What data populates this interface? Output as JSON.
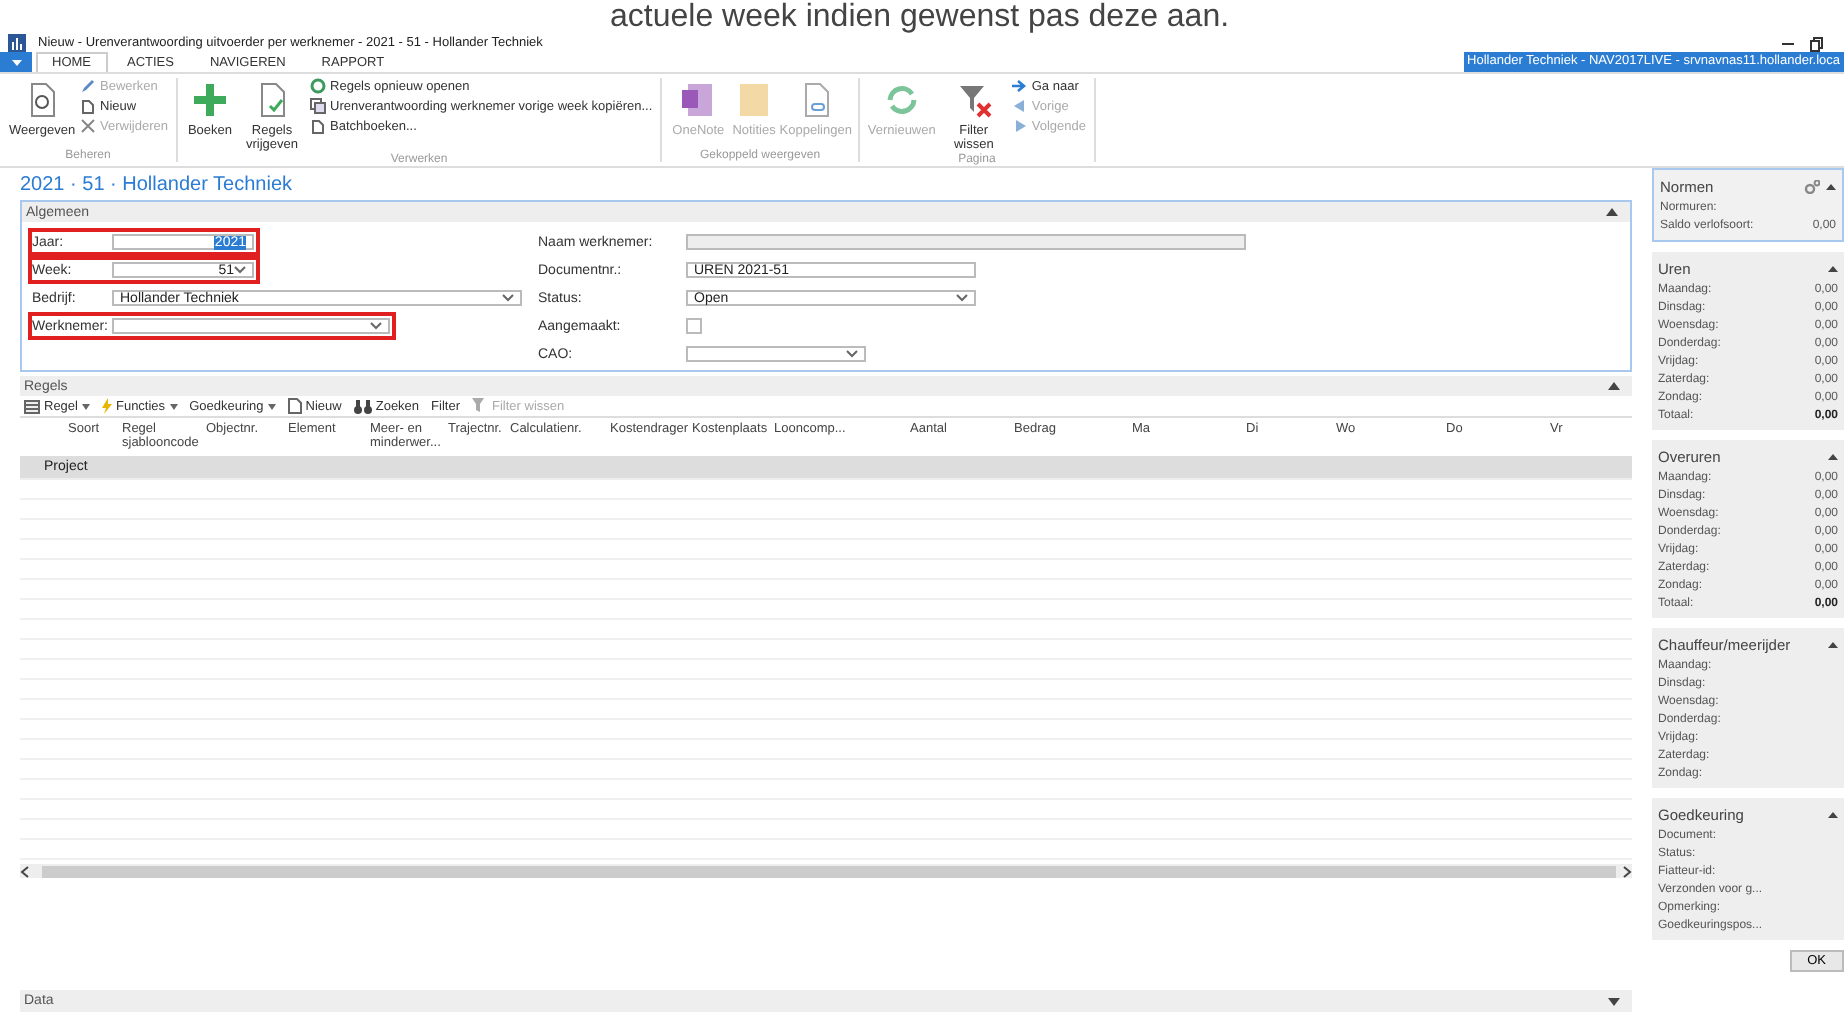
{
  "caption": "actuele week indien gewenst pas deze aan.",
  "window": {
    "title": "Nieuw - Urenverantwoording uitvoerder per werknemer - 2021 - 51 - Hollander Techniek"
  },
  "ribbon": {
    "tabs": [
      {
        "label": "HOME",
        "selected": true
      },
      {
        "label": "ACTIES",
        "selected": false
      },
      {
        "label": "NAVIGEREN",
        "selected": false
      },
      {
        "label": "RAPPORT",
        "selected": false
      }
    ],
    "server": "Hollander Techniek - NAV2017LIVE - srvnavnas11.hollander.loca",
    "groups": [
      {
        "label": "Beheren",
        "large": [
          {
            "label": "Weergeven",
            "disabled": false
          }
        ],
        "small": [
          {
            "label": "Bewerken",
            "disabled": true
          },
          {
            "label": "Nieuw",
            "disabled": false
          },
          {
            "label": "Verwijderen",
            "disabled": true
          }
        ]
      },
      {
        "label": "Verwerken",
        "large": [
          {
            "label": "Boeken",
            "disabled": false
          },
          {
            "label": "Regels vrijgeven",
            "disabled": false
          }
        ],
        "small": [
          {
            "label": "Regels opnieuw openen",
            "disabled": false
          },
          {
            "label": "Urenverantwoording werknemer vorige week kopiëren...",
            "disabled": false
          },
          {
            "label": "Batchboeken...",
            "disabled": false
          }
        ]
      },
      {
        "label": "Gekoppeld weergeven",
        "large": [
          {
            "label": "OneNote",
            "disabled": true
          },
          {
            "label": "Notities",
            "disabled": true
          },
          {
            "label": "Koppelingen",
            "disabled": true
          }
        ]
      },
      {
        "label": "Pagina",
        "large": [
          {
            "label": "Vernieuwen",
            "disabled": true
          },
          {
            "label": "Filter wissen",
            "disabled": false
          }
        ],
        "small": [
          {
            "label": "Ga naar",
            "disabled": false
          },
          {
            "label": "Vorige",
            "disabled": true
          },
          {
            "label": "Volgende",
            "disabled": true
          }
        ]
      }
    ]
  },
  "page_title": "2021 · 51 · Hollander Techniek",
  "algemeen": {
    "title": "Algemeen",
    "left_fields": [
      {
        "label": "Jaar:",
        "value": "2021",
        "kind": "number",
        "value_selected": true,
        "highlighted": true
      },
      {
        "label": "Week:",
        "value": "51",
        "kind": "number-dropdown",
        "highlighted": true
      },
      {
        "label": "Bedrijf:",
        "value": "Hollander Techniek",
        "kind": "dropdown",
        "highlighted": false
      },
      {
        "label": "Werknemer:",
        "kind": "dropdown",
        "highlighted": true
      }
    ],
    "right_fields": [
      {
        "label": "Naam werknemer:",
        "kind": "readonly"
      },
      {
        "label": "Documentnr.:",
        "value": "UREN 2021-51",
        "kind": "text"
      },
      {
        "label": "Status:",
        "value": "Open",
        "kind": "dropdown"
      },
      {
        "label": "Aangemaakt:",
        "kind": "checkbox",
        "checked": false
      },
      {
        "label": "CAO:",
        "kind": "dropdown"
      }
    ]
  },
  "regels": {
    "title": "Regels",
    "toolbar": [
      {
        "label": "Regel",
        "dropdown": true,
        "disabled": false
      },
      {
        "label": "Functies",
        "dropdown": true,
        "disabled": false
      },
      {
        "label": "Goedkeuring",
        "dropdown": true,
        "disabled": false
      },
      {
        "label": "Nieuw",
        "disabled": false
      },
      {
        "label": "Zoeken",
        "disabled": false
      },
      {
        "label": "Filter",
        "disabled": false
      },
      {
        "label": "Filter wissen",
        "disabled": true
      }
    ],
    "columns": [
      "Soort",
      "Regel sjablooncode",
      "Objectnr.",
      "Element",
      "Meer- en minderwer...",
      "Trajectnr.",
      "Calculatienr.",
      "Kostendrager",
      "Kostenplaats",
      "Looncomp...",
      "Aantal",
      "Bedrag",
      "Ma",
      "Di",
      "Wo",
      "Do",
      "Vr"
    ],
    "rows": [
      {
        "soort": "Project",
        "selected": true
      }
    ]
  },
  "data_section": {
    "title": "Data"
  },
  "factboxes": [
    {
      "title": "Normen",
      "settings": true,
      "rows": [
        {
          "label": "Normuren:"
        },
        {
          "label": "Saldo verlofsoort:",
          "value": "0,00"
        }
      ]
    },
    {
      "title": "Uren",
      "rows": [
        {
          "label": "Maandag:",
          "value": "0,00"
        },
        {
          "label": "Dinsdag:",
          "value": "0,00"
        },
        {
          "label": "Woensdag:",
          "value": "0,00"
        },
        {
          "label": "Donderdag:",
          "value": "0,00"
        },
        {
          "label": "Vrijdag:",
          "value": "0,00"
        },
        {
          "label": "Zaterdag:",
          "value": "0,00"
        },
        {
          "label": "Zondag:",
          "value": "0,00"
        },
        {
          "label": "Totaal:",
          "value": "0,00",
          "bold": true
        }
      ]
    },
    {
      "title": "Overuren",
      "rows": [
        {
          "label": "Maandag:",
          "value": "0,00"
        },
        {
          "label": "Dinsdag:",
          "value": "0,00"
        },
        {
          "label": "Woensdag:",
          "value": "0,00"
        },
        {
          "label": "Donderdag:",
          "value": "0,00"
        },
        {
          "label": "Vrijdag:",
          "value": "0,00"
        },
        {
          "label": "Zaterdag:",
          "value": "0,00"
        },
        {
          "label": "Zondag:",
          "value": "0,00"
        },
        {
          "label": "Totaal:",
          "value": "0,00",
          "bold": true
        }
      ]
    },
    {
      "title": "Chauffeur/meerijder",
      "rows": [
        {
          "label": "Maandag:"
        },
        {
          "label": "Dinsdag:"
        },
        {
          "label": "Woensdag:"
        },
        {
          "label": "Donderdag:"
        },
        {
          "label": "Vrijdag:"
        },
        {
          "label": "Zaterdag:"
        },
        {
          "label": "Zondag:"
        }
      ]
    },
    {
      "title": "Goedkeuring",
      "rows": [
        {
          "label": "Document:"
        },
        {
          "label": "Status:"
        },
        {
          "label": "Fiatteur-id:"
        },
        {
          "label": "Verzonden voor g..."
        },
        {
          "label": "Opmerking:"
        },
        {
          "label": "Goedkeuringspos..."
        }
      ]
    }
  ],
  "ok_button": "OK"
}
